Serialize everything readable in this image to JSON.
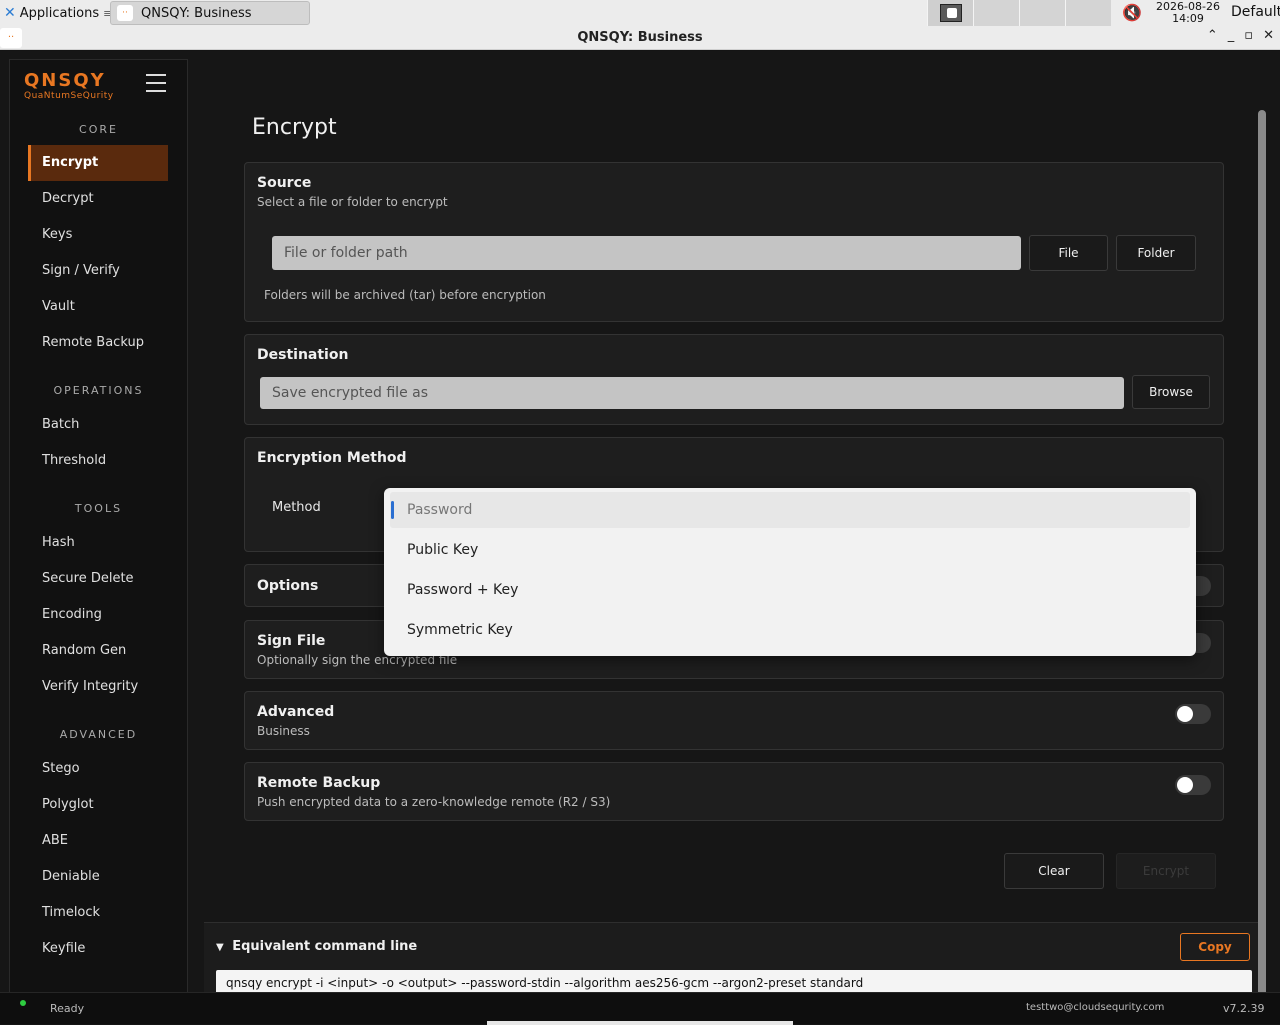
{
  "taskbar": {
    "applications_label": "Applications",
    "task_label": "QNSQY: Business",
    "clock_date": "2026-08-26",
    "clock_time": "14:09",
    "user_label": "Default"
  },
  "window": {
    "title": "QNSQY: Business"
  },
  "sidebar": {
    "logo_main": "QNSQY",
    "logo_sub": "QuaNtumSeQurity",
    "sections": {
      "core": "CORE",
      "operations": "OPERATIONS",
      "tools": "TOOLS",
      "advanced": "ADVANCED"
    },
    "items": {
      "encrypt": "Encrypt",
      "decrypt": "Decrypt",
      "keys": "Keys",
      "sign_verify": "Sign / Verify",
      "vault": "Vault",
      "remote_backup": "Remote Backup",
      "batch": "Batch",
      "threshold": "Threshold",
      "hash": "Hash",
      "secure_delete": "Secure Delete",
      "encoding": "Encoding",
      "random_gen": "Random Gen",
      "verify_integrity": "Verify Integrity",
      "stego": "Stego",
      "polyglot": "Polyglot",
      "abe": "ABE",
      "deniable": "Deniable",
      "timelock": "Timelock",
      "keyfile": "Keyfile"
    }
  },
  "main": {
    "title": "Encrypt",
    "source": {
      "title": "Source",
      "subtitle": "Select a file or folder to encrypt",
      "placeholder": "File or folder path",
      "file_button": "File",
      "folder_button": "Folder",
      "hint": "Folders will be archived (tar) before encryption"
    },
    "destination": {
      "title": "Destination",
      "placeholder": "Save encrypted file as",
      "browse_button": "Browse"
    },
    "method": {
      "title": "Encryption Method",
      "label": "Method",
      "options": [
        "Password",
        "Public Key",
        "Password + Key",
        "Symmetric Key"
      ],
      "selected": "Password"
    },
    "options": {
      "title": "Options"
    },
    "sign_file": {
      "title": "Sign File",
      "subtitle": "Optionally sign the encrypted file"
    },
    "advanced": {
      "title": "Advanced",
      "subtitle": "Business"
    },
    "remote_backup": {
      "title": "Remote Backup",
      "subtitle": "Push encrypted data to a zero-knowledge remote (R2 / S3)"
    },
    "clear_button": "Clear",
    "encrypt_button": "Encrypt"
  },
  "command": {
    "heading": "Equivalent command line",
    "copy_button": "Copy",
    "text": "qnsqy encrypt -i <input> -o <output> --password-stdin --algorithm aes256-gcm --argon2-preset standard"
  },
  "status": {
    "text": "Ready",
    "user": "testtwo@cloudsequrity.com",
    "version": "v7.2.39"
  },
  "colors": {
    "accent": "#e87722",
    "active_nav_bg": "#5a2a0d",
    "status_ok": "#2ecc40"
  }
}
